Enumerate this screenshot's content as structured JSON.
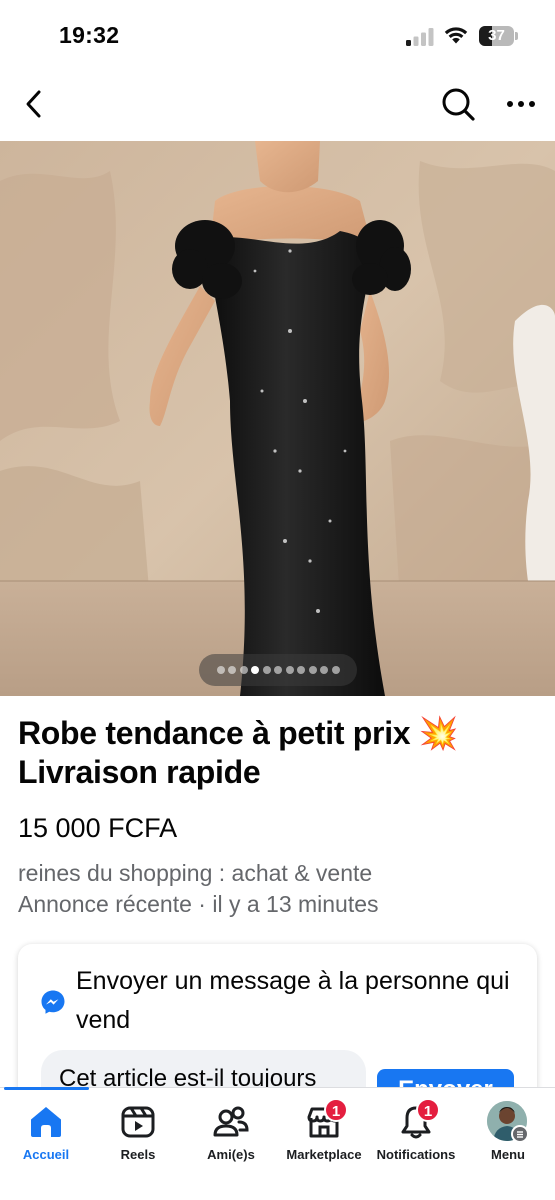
{
  "status_bar": {
    "time": "19:32",
    "battery": "37"
  },
  "top_nav": {
    "back_icon": "chevron-left",
    "search_icon": "magnifier",
    "more_icon": "three-dots"
  },
  "listing": {
    "photo_count": 11,
    "active_photo_index": 4,
    "title_line1": "Robe tendance à petit prix 💥",
    "title_line2": "Livraison rapide",
    "price": "15 000 FCFA",
    "seller": "reines du shopping : achat & vente",
    "posted": "Annonce récente · il y a 13 minutes"
  },
  "message_card": {
    "heading_line1": "Envoyer un message à la personne qui",
    "heading_line2": "vend",
    "input_value": "Cet article est-il toujours",
    "send_label": "Envoyer"
  },
  "tab_bar": {
    "tabs": [
      {
        "label": "Accueil",
        "icon": "home-icon",
        "badge": ""
      },
      {
        "label": "Reels",
        "icon": "reels-icon",
        "badge": ""
      },
      {
        "label": "Ami(e)s",
        "icon": "friends-icon",
        "badge": ""
      },
      {
        "label": "Marketplace",
        "icon": "marketplace-icon",
        "badge": "1"
      },
      {
        "label": "Notifications",
        "icon": "bell-icon",
        "badge": "1"
      },
      {
        "label": "Menu",
        "icon": "avatar",
        "badge": ""
      }
    ]
  },
  "colors": {
    "accent": "#1877f2",
    "badge": "#e41e3f",
    "secondary_text": "#65676b"
  }
}
